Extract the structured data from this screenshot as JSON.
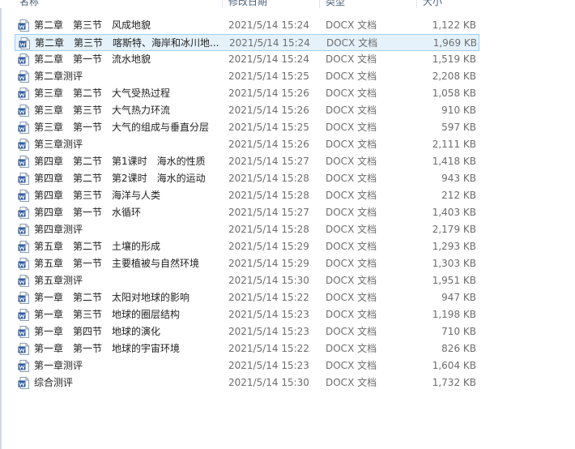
{
  "columns": {
    "name": "名称",
    "date": "修改日期",
    "type": "类型",
    "size": "大小"
  },
  "file_icon": "word-document-icon",
  "colors": {
    "icon_blue": "#2b579a",
    "selected_bg": "#e6f2fb",
    "selected_border": "#99d1ff"
  },
  "files": [
    {
      "name": "第二章　第三节　风成地貌",
      "date": "2021/5/14 15:24",
      "type": "DOCX 文档",
      "size": "1,122 KB"
    },
    {
      "name": "第二章　第三节　喀斯特、海岸和冰川地...",
      "date": "2021/5/14 15:24",
      "type": "DOCX 文档",
      "size": "1,969 KB",
      "selected": true
    },
    {
      "name": "第二章　第一节　流水地貌",
      "date": "2021/5/14 15:24",
      "type": "DOCX 文档",
      "size": "1,519 KB"
    },
    {
      "name": "第二章测评",
      "date": "2021/5/14 15:25",
      "type": "DOCX 文档",
      "size": "2,208 KB"
    },
    {
      "name": "第三章　第二节　大气受热过程",
      "date": "2021/5/14 15:26",
      "type": "DOCX 文档",
      "size": "1,058 KB"
    },
    {
      "name": "第三章　第三节　大气热力环流",
      "date": "2021/5/14 15:26",
      "type": "DOCX 文档",
      "size": "910 KB"
    },
    {
      "name": "第三章　第一节　大气的组成与垂直分层",
      "date": "2021/5/14 15:25",
      "type": "DOCX 文档",
      "size": "597 KB"
    },
    {
      "name": "第三章测评",
      "date": "2021/5/14 15:26",
      "type": "DOCX 文档",
      "size": "2,111 KB"
    },
    {
      "name": "第四章　第二节　第1课时　海水的性质",
      "date": "2021/5/14 15:27",
      "type": "DOCX 文档",
      "size": "1,418 KB"
    },
    {
      "name": "第四章　第二节　第2课时　海水的运动",
      "date": "2021/5/14 15:28",
      "type": "DOCX 文档",
      "size": "943 KB"
    },
    {
      "name": "第四章　第三节　海洋与人类",
      "date": "2021/5/14 15:28",
      "type": "DOCX 文档",
      "size": "212 KB"
    },
    {
      "name": "第四章　第一节　水循环",
      "date": "2021/5/14 15:27",
      "type": "DOCX 文档",
      "size": "1,403 KB"
    },
    {
      "name": "第四章测评",
      "date": "2021/5/14 15:28",
      "type": "DOCX 文档",
      "size": "2,179 KB"
    },
    {
      "name": "第五章　第二节　土壤的形成",
      "date": "2021/5/14 15:29",
      "type": "DOCX 文档",
      "size": "1,293 KB"
    },
    {
      "name": "第五章　第一节　主要植被与自然环境",
      "date": "2021/5/14 15:29",
      "type": "DOCX 文档",
      "size": "1,303 KB"
    },
    {
      "name": "第五章测评",
      "date": "2021/5/14 15:30",
      "type": "DOCX 文档",
      "size": "1,951 KB"
    },
    {
      "name": "第一章　第二节　太阳对地球的影响",
      "date": "2021/5/14 15:22",
      "type": "DOCX 文档",
      "size": "947 KB"
    },
    {
      "name": "第一章　第三节　地球的圈层结构",
      "date": "2021/5/14 15:23",
      "type": "DOCX 文档",
      "size": "1,198 KB"
    },
    {
      "name": "第一章　第四节　地球的演化",
      "date": "2021/5/14 15:23",
      "type": "DOCX 文档",
      "size": "710 KB"
    },
    {
      "name": "第一章　第一节　地球的宇宙环境",
      "date": "2021/5/14 15:22",
      "type": "DOCX 文档",
      "size": "826 KB"
    },
    {
      "name": "第一章测评",
      "date": "2021/5/14 15:23",
      "type": "DOCX 文档",
      "size": "1,604 KB"
    },
    {
      "name": "综合测评",
      "date": "2021/5/14 15:30",
      "type": "DOCX 文档",
      "size": "1,732 KB"
    }
  ]
}
